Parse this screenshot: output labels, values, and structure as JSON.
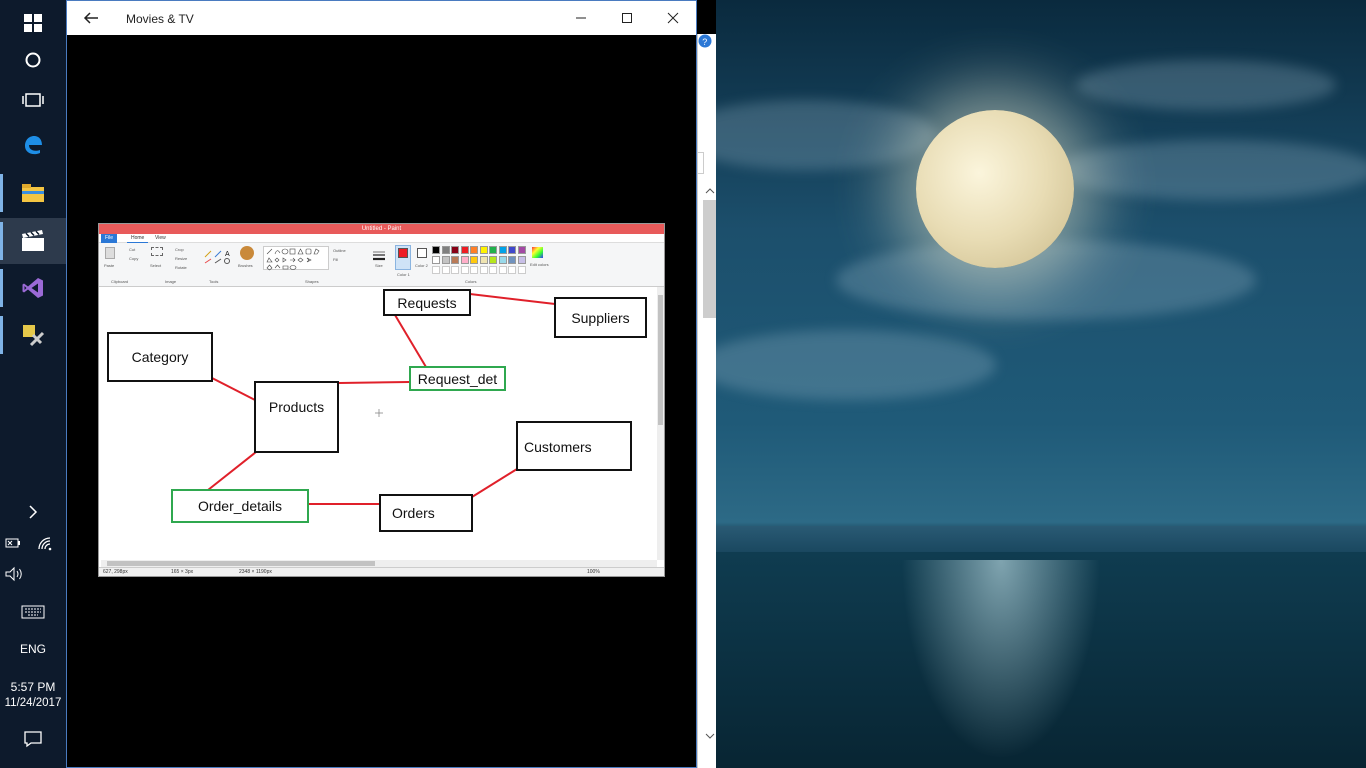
{
  "window": {
    "title": "Movies & TV"
  },
  "paint": {
    "title": "Untitled - Paint",
    "tabs": [
      "File",
      "Home",
      "View"
    ],
    "groups": [
      "Clipboard",
      "Image",
      "Tools",
      "Shapes",
      "Colors"
    ],
    "tools": [
      "Paste",
      "Cut",
      "Copy",
      "Select",
      "Crop",
      "Resize",
      "Rotate",
      "Brushes",
      "Outline",
      "Fill",
      "Size",
      "Color 1",
      "Color 2",
      "Edit colors"
    ],
    "status": {
      "cursor": "627, 298px",
      "selection": "165 × 3px",
      "image_size": "2348 × 1190px",
      "zoom": "100%"
    },
    "palette": [
      "#000000",
      "#7f7f7f",
      "#880015",
      "#ed1c24",
      "#ff7f27",
      "#fff200",
      "#22b14c",
      "#00a2e8",
      "#3f48cc",
      "#a349a4",
      "#ffffff",
      "#c3c3c3",
      "#b97a57",
      "#ffaec9",
      "#ffc90e",
      "#efe4b0",
      "#b5e61d",
      "#99d9ea",
      "#7092be",
      "#c8bfe7"
    ],
    "color1": "#ed1c24",
    "diagram": {
      "requests": "Requests",
      "suppliers": "Suppliers",
      "category": "Category",
      "products": "Products",
      "request_det": "Request_det",
      "customers": "Customers",
      "order_details": "Order_details",
      "orders": "Orders"
    }
  },
  "taskbar": {
    "language": "ENG",
    "time": "5:57 PM",
    "date": "11/24/2017",
    "apps": [
      "start-icon",
      "cortana-icon",
      "task-view-icon",
      "edge-icon",
      "file-explorer-icon",
      "movies-tv-icon",
      "visual-studio-icon",
      "tools-icon"
    ]
  },
  "colors": {
    "taskbar": "#0d1a2c",
    "accent": "#4a7bc0",
    "line_red": "#e0202a",
    "box_green": "#2fa84f"
  }
}
